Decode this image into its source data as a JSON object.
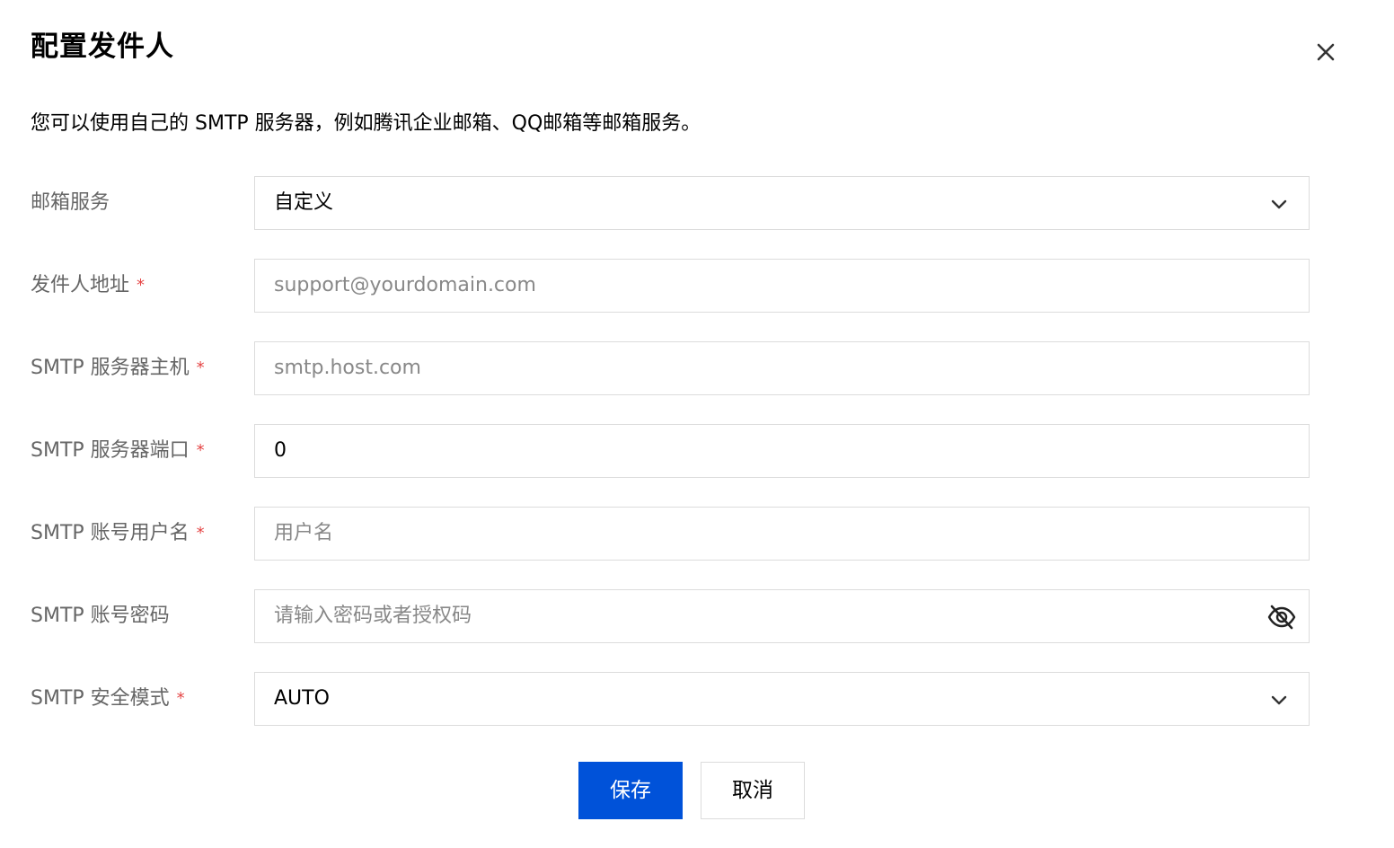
{
  "dialog": {
    "title": "配置发件人",
    "description": "您可以使用自己的 SMTP 服务器，例如腾讯企业邮箱、QQ邮箱等邮箱服务。",
    "close_icon": "close-icon"
  },
  "form": {
    "required_mark": "*",
    "mail_service": {
      "label": "邮箱服务",
      "value": "自定义",
      "required": false
    },
    "sender_address": {
      "label": "发件人地址",
      "value": "",
      "placeholder": "support@yourdomain.com",
      "required": true
    },
    "smtp_host": {
      "label": "SMTP 服务器主机",
      "value": "",
      "placeholder": "smtp.host.com",
      "required": true
    },
    "smtp_port": {
      "label": "SMTP 服务器端口",
      "value": "0",
      "required": true
    },
    "smtp_username": {
      "label": "SMTP 账号用户名",
      "value": "",
      "placeholder": "用户名",
      "required": true
    },
    "smtp_password": {
      "label": "SMTP 账号密码",
      "value": "",
      "placeholder": "请输入密码或者授权码",
      "required": false,
      "toggle_icon": "eye-off-icon"
    },
    "smtp_security": {
      "label": "SMTP 安全模式",
      "value": "AUTO",
      "required": true
    }
  },
  "actions": {
    "save_label": "保存",
    "cancel_label": "取消"
  },
  "colors": {
    "primary": "#0052d9",
    "required": "#e54545",
    "label": "#666666",
    "placeholder": "#888888",
    "border": "#dcdcdc"
  }
}
